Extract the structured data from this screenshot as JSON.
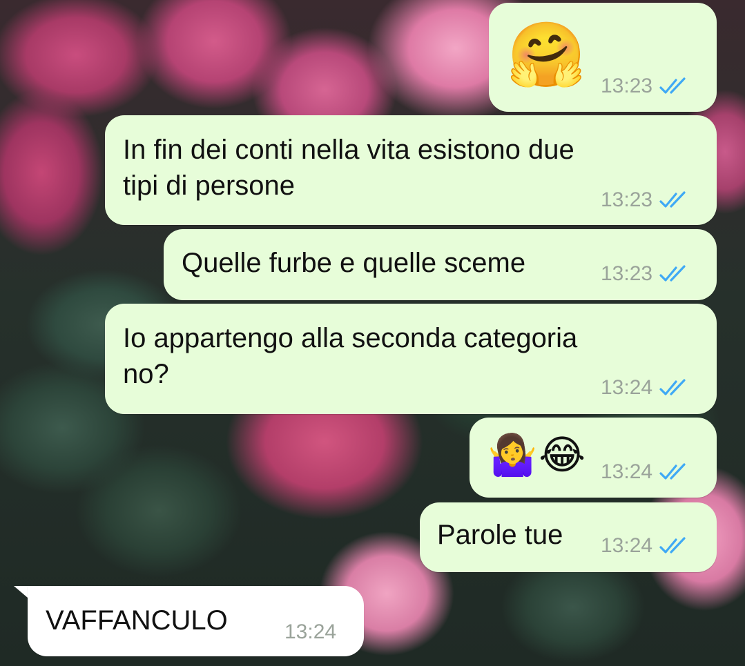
{
  "messages": [
    {
      "direction": "outgoing",
      "type": "emoji",
      "content": "🤗",
      "time": "13:23",
      "status": "read"
    },
    {
      "direction": "outgoing",
      "type": "text",
      "content": "In fin dei conti nella vita esistono due\ntipi di persone",
      "time": "13:23",
      "status": "read"
    },
    {
      "direction": "outgoing",
      "type": "text",
      "content": "Quelle furbe e quelle sceme",
      "time": "13:23",
      "status": "read"
    },
    {
      "direction": "outgoing",
      "type": "text",
      "content": "Io appartengo alla seconda categoria\nno?",
      "time": "13:24",
      "status": "read"
    },
    {
      "direction": "outgoing",
      "type": "emoji",
      "content": "🤷‍♀️😂",
      "time": "13:24",
      "status": "read"
    },
    {
      "direction": "outgoing",
      "type": "text",
      "content": "Parole tue",
      "time": "13:24",
      "status": "read"
    },
    {
      "direction": "incoming",
      "type": "text",
      "content": "VAFFANCULO",
      "time": "13:24"
    }
  ],
  "colors": {
    "outgoing_bubble": "#e7fdd9",
    "incoming_bubble": "#ffffff",
    "read_ticks": "#3fa9f5",
    "timestamp": "#9aa39a"
  },
  "icons": {
    "read_receipt": "double-check-icon"
  }
}
